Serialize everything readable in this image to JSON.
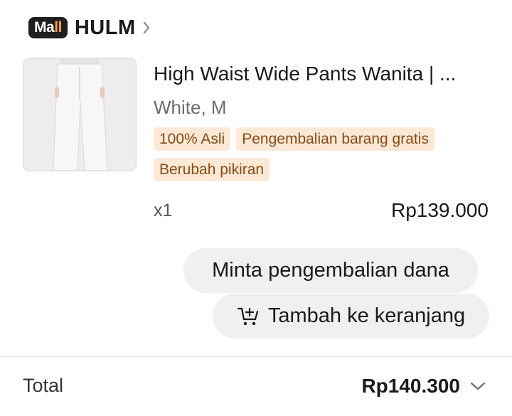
{
  "shop": {
    "badge_main": "Ma",
    "badge_accent": "ll",
    "name": "HULM"
  },
  "product": {
    "title": "High Waist Wide Pants Wanita | ...",
    "variant": "White, M",
    "tags": [
      "100% Asli",
      "Pengembalian barang gratis",
      "Berubah pikiran"
    ],
    "quantity": "x1",
    "price": "Rp139.000",
    "image_icon": "product-photo"
  },
  "actions": {
    "refund_label": "Minta pengembalian dana",
    "cart_label": "Tambah ke keranjang",
    "cart_icon": "add-to-cart-icon"
  },
  "footer": {
    "total_label": "Total",
    "total_value": "Rp140.300"
  },
  "colors": {
    "tag_bg": "#fbe9d6",
    "tag_text": "#8a4a12",
    "badge_accent": "#f7a23c",
    "button_bg": "#f0f0f0"
  }
}
